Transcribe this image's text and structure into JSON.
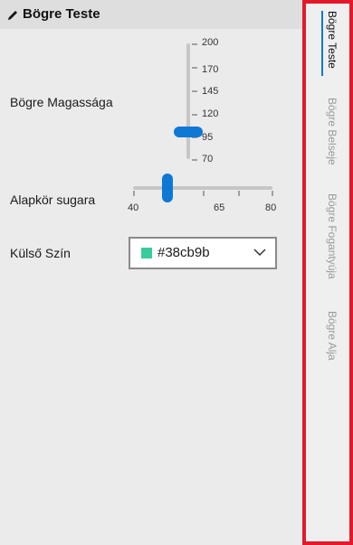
{
  "header": {
    "icon": "pencil-icon",
    "title": "Bögre Teste"
  },
  "form": {
    "height": {
      "label": "Bögre Magassága",
      "ticks": [
        "200",
        "170",
        "145",
        "120",
        "95",
        "70"
      ],
      "value": 100,
      "min": 70,
      "max": 200
    },
    "radius": {
      "label": "Alapkör sugara",
      "ticks": [
        "40",
        "65",
        "80"
      ],
      "value": 55,
      "min": 40,
      "max": 80
    },
    "color": {
      "label": "Külső Szín",
      "value": "#38cb9b",
      "swatch": "#38cb9b"
    }
  },
  "tabs": [
    {
      "label": "Bögre Teste",
      "active": true
    },
    {
      "label": "Bögre Belseje",
      "active": false
    },
    {
      "label": "Bögre Fogantyúja",
      "active": false
    },
    {
      "label": "Bögre Alja",
      "active": false
    }
  ],
  "colors": {
    "accent": "#0f78d4",
    "highlight_border": "#e3192b"
  }
}
